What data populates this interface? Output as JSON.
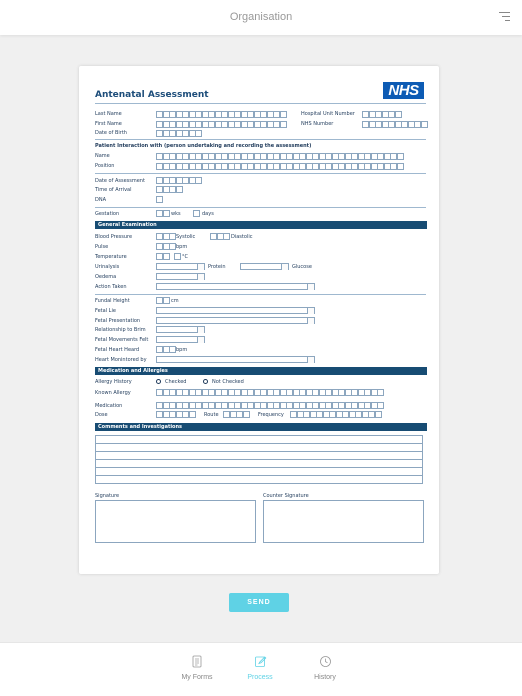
{
  "header": {
    "title": "Organisation"
  },
  "form": {
    "title": "Antenatal Assessment",
    "logo_text": "NHS",
    "patient": {
      "last_name": "Last Name",
      "first_name": "First Name",
      "dob": "Date of Birth",
      "hospital_unit_number": "Hospital Unit Number",
      "nhs_number": "NHS Number"
    },
    "interaction": {
      "heading": "Patient Interaction with (person undertaking and recording the assessment)",
      "name": "Name",
      "position": "Position"
    },
    "assessment": {
      "date": "Date of Assessment",
      "time": "Time of Arrival",
      "dna": "DNA",
      "gestation": "Gestation",
      "wks": "wks",
      "days": "days"
    },
    "general": {
      "heading": "General Examination",
      "bp": "Blood Pressure",
      "systolic": "Systolic",
      "diastolic": "Diastolic",
      "pulse": "Pulse",
      "bpm": "bpm",
      "temperature": "Temperature",
      "celsius": "°C",
      "urinalysis": "Urinalysis",
      "protein": "Protein",
      "glucose": "Glucose",
      "oedema": "Oedema",
      "action": "Action Taken"
    },
    "fetal": {
      "fundal": "Fundal Height",
      "cm": "cm",
      "lie": "Fetal Lie",
      "presentation": "Fetal Presentation",
      "relationship": "Relationship to Brim",
      "movements": "Fetal Movements Felt",
      "heart": "Fetal Heart Heard",
      "bpm": "bpm",
      "monitored": "Heart Monintored by"
    },
    "medication": {
      "heading": "Medication and Allergies",
      "allergy_history": "Allergy History",
      "checked": "Checked",
      "not_checked": "Not Checked",
      "known_allergy": "Known Allergy",
      "medication": "Medication",
      "dose": "Dose",
      "route": "Route",
      "frequency": "Frequency"
    },
    "comments": {
      "heading": "Comments and Investigations"
    },
    "signature": "Signature",
    "counter_signature": "Counter Signature"
  },
  "actions": {
    "send": "SEND"
  },
  "tabs": [
    {
      "label": "My Forms",
      "icon": "document-icon"
    },
    {
      "label": "Process",
      "icon": "edit-icon"
    },
    {
      "label": "History",
      "icon": "clock-icon"
    }
  ],
  "colors": {
    "accent": "#5fd2e5",
    "nhs_blue": "#0d5bb4",
    "section_band": "#174c73"
  }
}
